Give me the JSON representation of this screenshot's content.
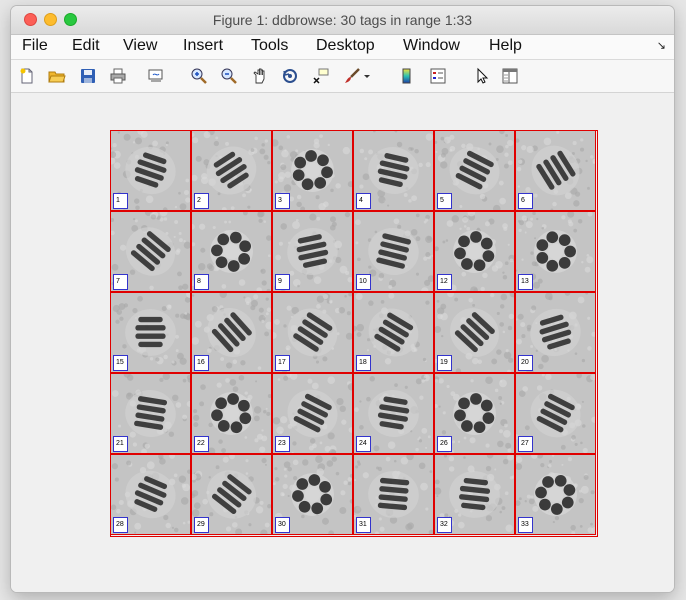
{
  "window": {
    "title": "Figure 1: ddbrowse: 30 tags in range 1:33"
  },
  "menu": {
    "items": [
      "File",
      "Edit",
      "View",
      "Insert",
      "Tools",
      "Desktop",
      "Window",
      "Help"
    ]
  },
  "toolbar": {
    "icons": [
      "new-figure-icon",
      "open-file-icon",
      "save-icon",
      "print-icon",
      "link-plot-icon",
      "zoom-in-icon",
      "zoom-out-icon",
      "pan-hand-icon",
      "rotate-3d-icon",
      "data-cursor-icon",
      "brush-icon",
      "brush-dropdown-icon",
      "colorbar-icon",
      "legend-icon",
      "pointer-icon",
      "property-editor-icon"
    ]
  },
  "tiles": [
    {
      "tag": "1",
      "kind": "side"
    },
    {
      "tag": "2",
      "kind": "side"
    },
    {
      "tag": "3",
      "kind": "ring"
    },
    {
      "tag": "4",
      "kind": "side"
    },
    {
      "tag": "5",
      "kind": "tilt"
    },
    {
      "tag": "6",
      "kind": "tilt"
    },
    {
      "tag": "7",
      "kind": "tilt"
    },
    {
      "tag": "8",
      "kind": "ring"
    },
    {
      "tag": "9",
      "kind": "side"
    },
    {
      "tag": "10",
      "kind": "tilt"
    },
    {
      "tag": "12",
      "kind": "ring"
    },
    {
      "tag": "13",
      "kind": "ring"
    },
    {
      "tag": "15",
      "kind": "side"
    },
    {
      "tag": "16",
      "kind": "tilt"
    },
    {
      "tag": "17",
      "kind": "tilt"
    },
    {
      "tag": "18",
      "kind": "tilt"
    },
    {
      "tag": "19",
      "kind": "tilt"
    },
    {
      "tag": "20",
      "kind": "side"
    },
    {
      "tag": "21",
      "kind": "tilt"
    },
    {
      "tag": "22",
      "kind": "ring"
    },
    {
      "tag": "23",
      "kind": "tilt"
    },
    {
      "tag": "24",
      "kind": "side"
    },
    {
      "tag": "26",
      "kind": "ring"
    },
    {
      "tag": "27",
      "kind": "tilt"
    },
    {
      "tag": "28",
      "kind": "side"
    },
    {
      "tag": "29",
      "kind": "tilt"
    },
    {
      "tag": "30",
      "kind": "ring"
    },
    {
      "tag": "31",
      "kind": "tilt"
    },
    {
      "tag": "32",
      "kind": "side"
    },
    {
      "tag": "33",
      "kind": "ring"
    }
  ],
  "colors": {
    "grid_border": "#e00000",
    "tag_border": "#3333cc"
  }
}
